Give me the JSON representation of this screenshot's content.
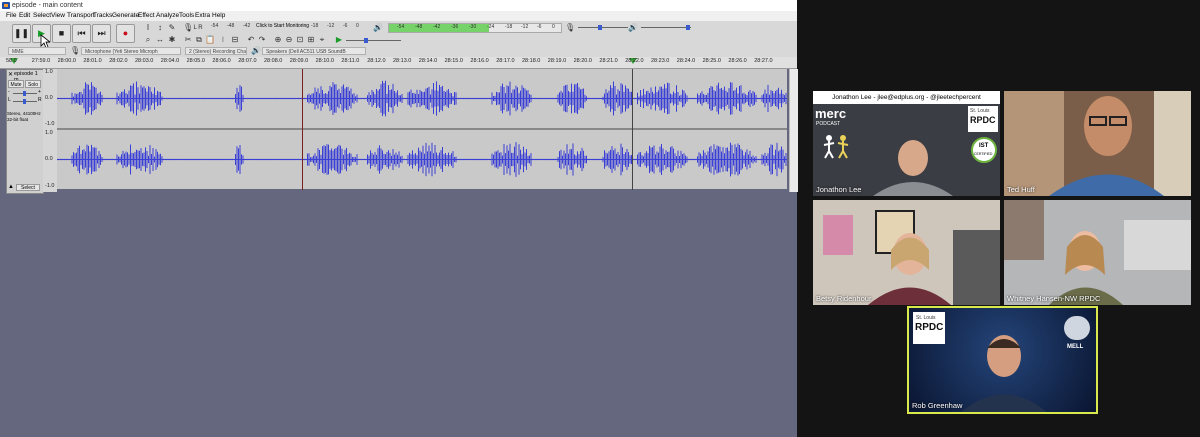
{
  "audacity": {
    "title": "episode - main content",
    "menu": [
      "File",
      "Edit",
      "Select",
      "View",
      "Transport",
      "Tracks",
      "Generate",
      "Effect",
      "Analyze",
      "Tools",
      "Extra",
      "Help"
    ],
    "monitoring_text": "Click to Start Monitoring",
    "rec_meter_ticks": [
      "-54",
      "-48",
      "-42",
      "",
      "-18",
      "-12",
      "-6",
      "0"
    ],
    "play_meter_ticks": [
      "-54",
      "-48",
      "-42",
      "-36",
      "-30",
      "-24",
      "-18",
      "-12",
      "-6",
      "0"
    ],
    "host": "MME",
    "mic_device": "Microphone (Yeti Stereo Microph",
    "channels": "2 (Stereo) Recording Chan",
    "speaker_device": "Speakers (Dell AC511 USB SoundB",
    "ruler": [
      "58.0",
      "27:59.0",
      "28:00.0",
      "28:01.0",
      "28:02.0",
      "28:03.0",
      "28:04.0",
      "28:05.0",
      "28:06.0",
      "28:07.0",
      "28:08.0",
      "28:09.0",
      "28:10.0",
      "28:11.0",
      "28:12.0",
      "28:13.0",
      "28:14.0",
      "28:15.0",
      "28:16.0",
      "28:17.0",
      "28:18.0",
      "28:19.0",
      "28:20.0",
      "28:21.0",
      "28:22.0",
      "28:23.0",
      "28:24.0",
      "28:25.0",
      "28:26.0",
      "28:27.0"
    ],
    "track": {
      "name": "episode 1 m",
      "mute": "Mute",
      "solo": "Solo",
      "info1": "Stereo, 44100Hz",
      "info2": "32-bit float",
      "select": "Select"
    },
    "scale": [
      "1.0",
      "0.0",
      "-1.0"
    ]
  },
  "zoom": {
    "participants": [
      {
        "name": "Jonathon Lee"
      },
      {
        "name": "Ted Huff"
      },
      {
        "name": "Betsy Ridenhour"
      },
      {
        "name": "Whitney Hansen-NW RPDC"
      },
      {
        "name": "Rob Greenhaw"
      }
    ],
    "banner": "Jonathon Lee - jlee@edplus.org - @jleetechpercent",
    "logo_merc": "merc",
    "logo_podcast": "PODCAST",
    "logo_rpdc": "RPDC",
    "logo_stlouis": "St. Louis",
    "logo_mell": "MELL",
    "badge_ist": "IST",
    "badge_certified": "CERTIFIED"
  }
}
